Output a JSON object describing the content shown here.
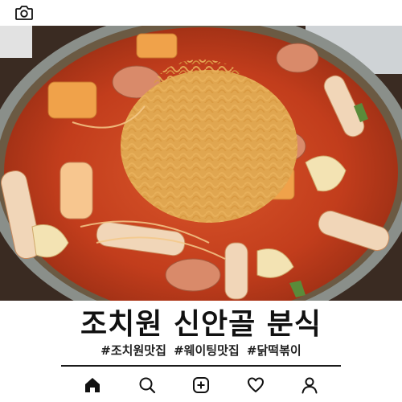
{
  "title": "조치원 신안골 분식",
  "hashtags": [
    "#조치원맛집",
    "#웨이팅맛집",
    "#닭떡볶이"
  ],
  "icons": {
    "top": "camera-icon",
    "nav": [
      "home-icon",
      "search-icon",
      "add-post-icon",
      "heart-icon",
      "profile-icon"
    ]
  },
  "colors": {
    "sauce": "#c8401f",
    "text": "#111111",
    "divider": "#1a1a1a"
  }
}
